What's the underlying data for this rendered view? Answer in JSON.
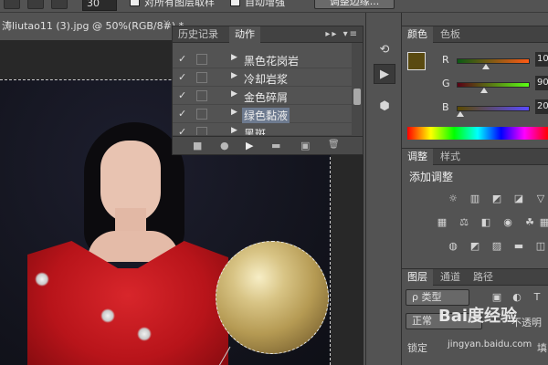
{
  "options_bar": {
    "size_value": "30",
    "sample_all_layers": "对所有图层取样",
    "auto_enhance": "自动增强",
    "refine_edge": "调整边缘..."
  },
  "document": {
    "tab_title": "涛liutao11 (3).jpg @ 50%(RGB/8#) *",
    "close": "×"
  },
  "actions_panel": {
    "tabs": [
      "历史记录",
      "动作"
    ],
    "menu_icons": "▸▸ ▾≡",
    "rows": [
      {
        "check": "✓",
        "label": "黑色花岗岩"
      },
      {
        "check": "✓",
        "label": "冷却岩浆"
      },
      {
        "check": "✓",
        "label": "金色碎屑"
      },
      {
        "check": "✓",
        "label": "绿色黏液"
      },
      {
        "check": "✓",
        "label": "黑斑"
      }
    ],
    "footer_icons": [
      "■",
      "●",
      "▶",
      "▬",
      "▣",
      "🗑"
    ]
  },
  "color_panel": {
    "tabs": [
      "颜色",
      "色板"
    ],
    "foreground": "#5a4a10",
    "channels": [
      {
        "name": "R",
        "value": "10"
      },
      {
        "name": "G",
        "value": "90"
      },
      {
        "name": "B",
        "value": "20"
      }
    ]
  },
  "adjust_panel": {
    "tabs": [
      "调整",
      "样式"
    ],
    "title": "添加调整"
  },
  "layers_panel": {
    "tabs": [
      "图层",
      "通道",
      "路径"
    ],
    "filter_kind": "ρ 类型",
    "blend_mode": "正常",
    "opacity_label": "不透明",
    "lock_label": "锁定",
    "fill_label": "填"
  },
  "watermark": {
    "brand": "Bai度经验",
    "url": "jingyan.baidu.com"
  }
}
